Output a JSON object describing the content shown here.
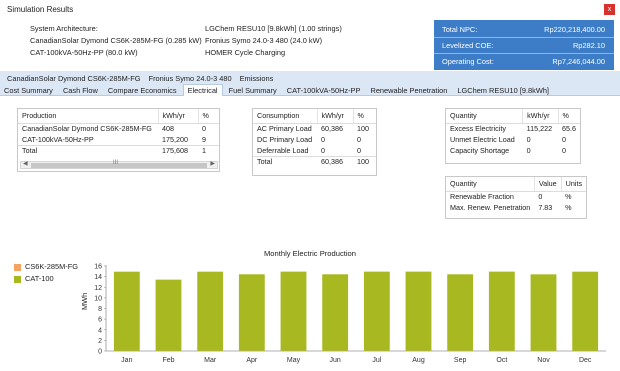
{
  "window": {
    "title": "Simulation Results",
    "close_label": "x"
  },
  "architecture": {
    "heading": "System Architecture:",
    "items": [
      "CanadianSolar Dymond CS6K-285M-FG (0.285 kW)",
      "CAT-100kVA-50Hz-PP (80.0 kW)",
      "LGChem RESU10 [9.8kWh] (1.00 strings)",
      "Fronius Symo 24.0-3 480 (24.0 kW)",
      "HOMER Cycle Charging"
    ]
  },
  "summary": {
    "rows": [
      {
        "label": "Total NPC:",
        "value": "Rp220,218,400.00"
      },
      {
        "label": "Levelized COE:",
        "value": "Rp282.10"
      },
      {
        "label": "Operating Cost:",
        "value": "Rp7,246,044.00"
      }
    ]
  },
  "component_tabs": [
    "CanadianSolar Dymond CS6K-285M-FG",
    "Fronius Symo 24.0-3 480",
    "Emissions"
  ],
  "tabs": [
    "Cost Summary",
    "Cash Flow",
    "Compare Economics",
    "Electrical",
    "Fuel Summary",
    "CAT-100kVA-50Hz-PP",
    "Renewable Penetration",
    "LGChem RESU10 [9.8kWh]"
  ],
  "active_tab": "Electrical",
  "production_table": {
    "headers": [
      "Production",
      "kWh/yr",
      "%"
    ],
    "rows": [
      [
        "CanadianSolar Dymond CS6K-285M-FG",
        "408",
        "0"
      ],
      [
        "CAT-100kVA-50Hz-PP",
        "175,200",
        "9"
      ],
      [
        "Total",
        "175,608",
        "1"
      ]
    ]
  },
  "consumption_table": {
    "headers": [
      "Consumption",
      "kWh/yr",
      "%"
    ],
    "rows": [
      [
        "AC Primary Load",
        "60,386",
        "100"
      ],
      [
        "DC Primary Load",
        "0",
        "0"
      ],
      [
        "Deferrable Load",
        "0",
        "0"
      ],
      [
        "Total",
        "60,386",
        "100"
      ]
    ]
  },
  "quantity_table": {
    "headers": [
      "Quantity",
      "kWh/yr",
      "%"
    ],
    "rows": [
      [
        "Excess Electricity",
        "115,222",
        "65.6"
      ],
      [
        "Unmet Electric Load",
        "0",
        "0"
      ],
      [
        "Capacity Shortage",
        "0",
        "0"
      ]
    ]
  },
  "renewable_table": {
    "headers": [
      "Quantity",
      "Value",
      "Units"
    ],
    "rows": [
      [
        "Renewable Fraction",
        "0",
        "%"
      ],
      [
        "Max. Renew. Penetration",
        "7.83",
        "%"
      ]
    ]
  },
  "scrollbar": {
    "grip_glyph": "III",
    "left_arrow": "◀",
    "right_arrow": "▶"
  },
  "colors": {
    "accent": "#3d7cc7",
    "cat_series": "#a8b820",
    "solar_series": "#f4a460"
  },
  "chart_data": {
    "type": "bar",
    "title": "Monthly Electric Production",
    "xlabel": "",
    "ylabel": "MWh",
    "categories": [
      "Jan",
      "Feb",
      "Mar",
      "Apr",
      "May",
      "Jun",
      "Jul",
      "Aug",
      "Sep",
      "Oct",
      "Nov",
      "Dec"
    ],
    "series": [
      {
        "name": "CS6K-285M-FG",
        "color": "#f4a460",
        "values": [
          0.03,
          0.03,
          0.03,
          0.04,
          0.04,
          0.04,
          0.04,
          0.04,
          0.04,
          0.04,
          0.03,
          0.03
        ]
      },
      {
        "name": "CAT-100",
        "color": "#a8b820",
        "values": [
          14.9,
          13.4,
          14.9,
          14.4,
          14.9,
          14.4,
          14.9,
          14.9,
          14.4,
          14.9,
          14.4,
          14.9
        ]
      }
    ],
    "yticks": [
      0,
      2,
      4,
      6,
      8,
      10,
      12,
      14,
      16
    ],
    "ylim": [
      0,
      16
    ],
    "grid": false,
    "legend": "left"
  }
}
